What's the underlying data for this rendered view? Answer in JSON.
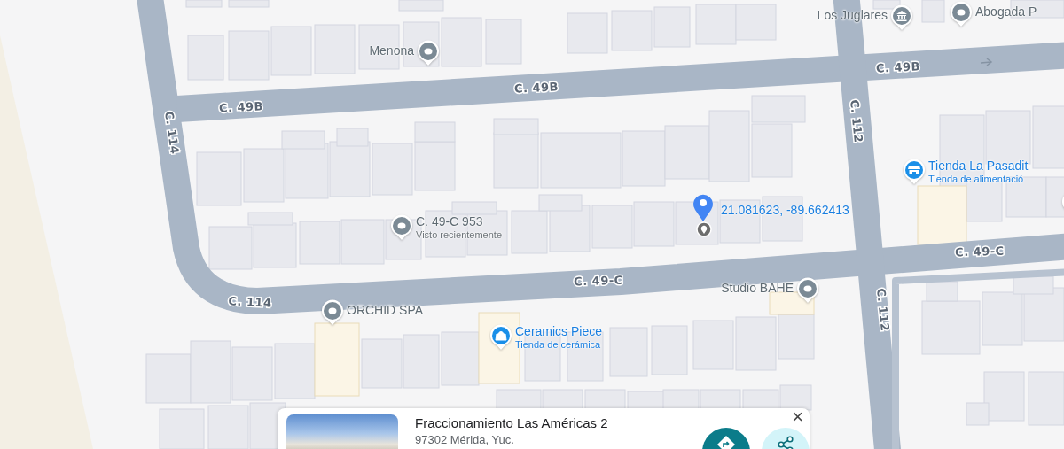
{
  "map": {
    "streets": [
      {
        "label": "C. 49B"
      },
      {
        "label": "C. 49B"
      },
      {
        "label": "C. 49B"
      },
      {
        "label": "C. 114"
      },
      {
        "label": "C. 114"
      },
      {
        "label": "C. 112"
      },
      {
        "label": "C. 112"
      },
      {
        "label": "C. 49-C"
      },
      {
        "label": "C. 49-C"
      }
    ],
    "places": [
      {
        "name": "Menona",
        "kind": "generic"
      },
      {
        "name": "Los Juglares",
        "kind": "landmark"
      },
      {
        "name": "Abogada P",
        "kind": "generic"
      },
      {
        "name": "Tienda La Pasadit",
        "kind": "store",
        "subtitle": "Tienda de alimentació"
      },
      {
        "name": "C. 49-C 953",
        "kind": "recent",
        "subtitle": "Visto recientemente"
      },
      {
        "name": "Studio BAHE",
        "kind": "generic"
      },
      {
        "name": "ORCHID SPA",
        "kind": "generic"
      },
      {
        "name": "Ceramics Piece",
        "kind": "shop",
        "subtitle": "Tienda de cerámica"
      }
    ],
    "dropped_pin": {
      "coordinates": "21.081623, -89.662413"
    }
  },
  "place_card": {
    "title": "Fraccionamiento Las Américas 2",
    "address": "97302 Mérida, Yuc.",
    "close": "×"
  }
}
